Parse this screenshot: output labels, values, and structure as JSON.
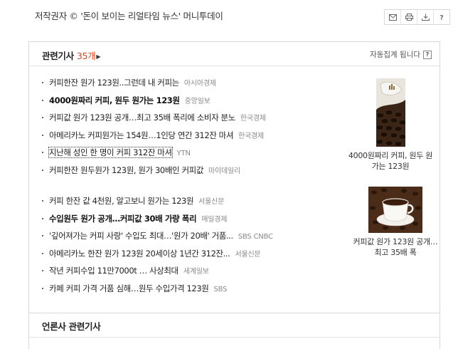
{
  "header": {
    "copyright": "저작권자 © '돈이 보이는 리얼타임 뉴스' 머니투데이",
    "tools": [
      {
        "icon": "email-icon"
      },
      {
        "icon": "print-icon"
      },
      {
        "icon": "download-icon"
      },
      {
        "icon": "help-icon"
      }
    ]
  },
  "related": {
    "title": "관련기사",
    "count": "35",
    "count_unit": "개",
    "arrow": "▶",
    "auto_note": "자동집계 됩니다",
    "help": "?",
    "group1": [
      {
        "headline": "커피한잔 원가 123원..그런데 내 커피는",
        "press": "아시아경제",
        "strong": false
      },
      {
        "headline": "4000원짜리 커피, 원두 원가는 123원",
        "press": "중앙일보",
        "strong": true
      },
      {
        "headline": "커피값 원가 123원 공개…최고 35배 폭리에 소비자 분노",
        "press": "한국경제",
        "strong": false
      },
      {
        "headline": "아메리카노 커피원가는 154원…1인당 연간 312잔 마셔",
        "press": "한국경제",
        "strong": false
      },
      {
        "headline": "지난해 성인 한 명이 커피 312잔 마셔",
        "press": "YTN",
        "strong": false,
        "focused": true
      },
      {
        "headline": "커피한잔 원두원가 123원, 원가 30배인 커피값",
        "press": "마이데일리",
        "strong": false
      }
    ],
    "group2": [
      {
        "headline": "커피 한잔 값 4천원, 알고보니 원가는 123원",
        "press": "서울신문",
        "strong": false
      },
      {
        "headline": "수입원두 원가 공개…커피값 30배 가량 폭리",
        "press": "매일경제",
        "strong": true
      },
      {
        "headline": "'깊어져가는 커피 사랑' 수입도 최대…'원가 20배' 거품...",
        "press": "SBS CNBC",
        "strong": false
      },
      {
        "headline": "아메리카노 한잔 원가 123원 20세이상 1년간 312잔...",
        "press": "서울신문",
        "strong": false
      },
      {
        "headline": "작년 커피수입 11만7000t … 사상최대",
        "press": "세계일보",
        "strong": false
      },
      {
        "headline": "카페 커피 가격 거품 심해…원두 수입가격 123원",
        "press": "SBS",
        "strong": false
      }
    ],
    "thumbs": [
      {
        "caption": "4000원짜리 커피, 원두 원가는 123원"
      },
      {
        "caption": "커피값 원가 123원 공개…최고 35배 폭"
      }
    ]
  },
  "press_related": {
    "title": "언론사 관련기사"
  },
  "colors": {
    "accent": "#e4451e",
    "border": "#d8d8d8"
  }
}
